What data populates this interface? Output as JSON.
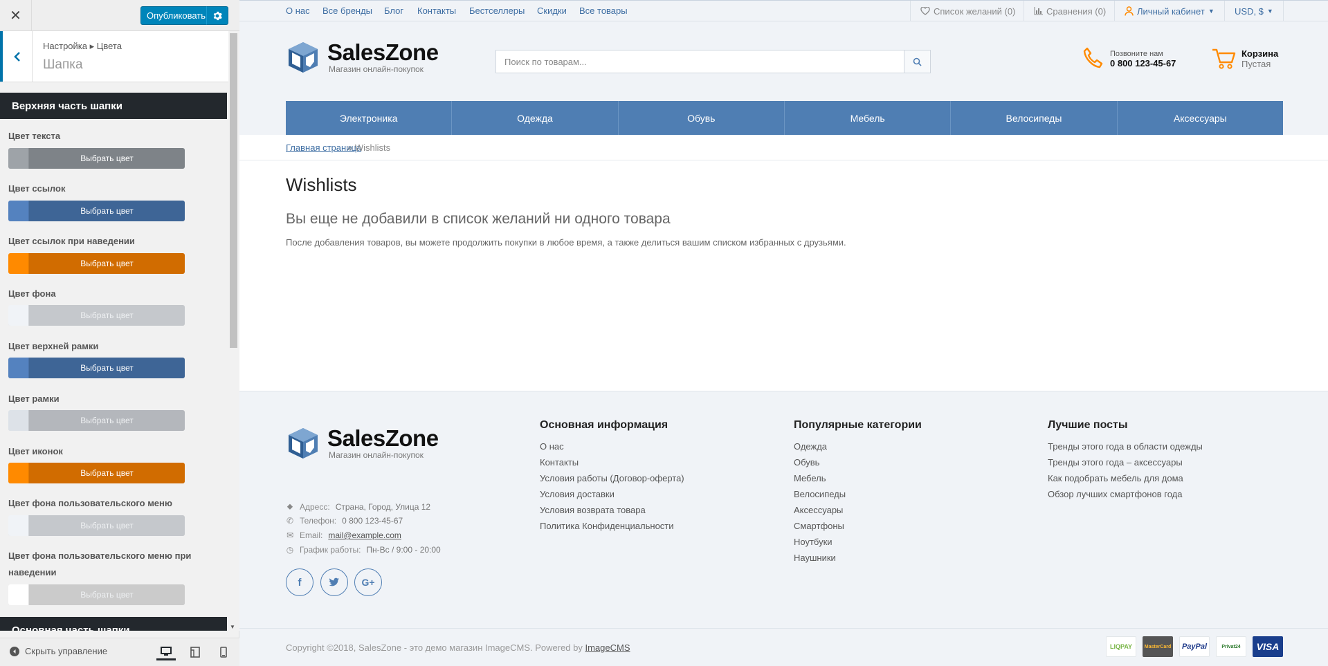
{
  "panel": {
    "publish_label": "Опубликовать",
    "breadcrumb": "Настройка ▸ Цвета",
    "section_title": "Шапка",
    "group_top": "Верхняя часть шапки",
    "group_main": "Основная часть шапки",
    "choose_color": "Выбрать цвет",
    "controls": [
      {
        "label": "Цвет текста",
        "color": "#9ea3a8",
        "btn_color": "#7e8388"
      },
      {
        "label": "Цвет ссылок",
        "color": "#5482bf",
        "btn_color": "#3e6596"
      },
      {
        "label": "Цвет ссылок при наведении",
        "color": "#ff8a00",
        "btn_color": "#d16c00"
      },
      {
        "label": "Цвет фона",
        "color": "#f0f3f7",
        "btn_color": "#c5c8cc"
      },
      {
        "label": "Цвет верхней рамки",
        "color": "#5482bf",
        "btn_color": "#3e6596"
      },
      {
        "label": "Цвет рамки",
        "color": "#dde2e8",
        "btn_color": "#b4b7bc"
      },
      {
        "label": "Цвет иконок",
        "color": "#ff8a00",
        "btn_color": "#d16c00"
      },
      {
        "label": "Цвет фона пользовательского меню",
        "color": "#f0f3f7",
        "btn_color": "#c5c8cc"
      },
      {
        "label": "Цвет фона пользовательского меню при наведении",
        "color": "#ffffff",
        "btn_color": "#cbcbcb"
      }
    ],
    "hide_controls": "Скрыть управление"
  },
  "site": {
    "topnav": [
      "О нас",
      "Все бренды",
      "Блог",
      "Контакты",
      "Бестселлеры",
      "Скидки",
      "Все товары"
    ],
    "wishlist": "Список желаний (0)",
    "compare": "Сравнения (0)",
    "account": "Личный кабинет",
    "currency": "USD, $",
    "logo_name": "SalesZone",
    "logo_tagline": "Магазин онлайн-покупок",
    "search_placeholder": "Поиск по товарам...",
    "phone_caption": "Позвоните нам",
    "phone_number": "0 800 123-45-67",
    "cart_title": "Корзина",
    "cart_status": "Пустая",
    "categories": [
      "Электроника",
      "Одежда",
      "Обувь",
      "Мебель",
      "Велосипеды",
      "Аксессуары"
    ],
    "crumb_home": "Главная страница",
    "crumb_current": "» Wishlists",
    "page_title": "Wishlists",
    "empty_title": "Вы еще не добавили в список желаний ни одного товара",
    "empty_text": "После добавления товаров, вы можете продолжить покупки в любое время, а также делиться вашим списком избранных с друзьями.",
    "address_label": "Адресс:",
    "address": "Страна, Город, Улица 12",
    "phone_label": "Телефон:",
    "email_label": "Email:",
    "email": "mail@example.com",
    "hours_label": "График работы:",
    "hours": "Пн-Вс / 9:00 - 20:00",
    "col1_title": "Основная информация",
    "col1_links": [
      "О нас",
      "Контакты",
      "Условия работы (Договор-оферта)",
      "Условия доставки",
      "Условия возврата товара",
      "Политика Конфиденциальности"
    ],
    "col2_title": "Популярные категории",
    "col2_links": [
      "Одежда",
      "Обувь",
      "Мебель",
      "Велосипеды",
      "Аксессуары",
      "Смартфоны",
      "Ноутбуки",
      "Наушники"
    ],
    "col3_title": "Лучшие посты",
    "col3_links": [
      "Тренды этого года в области одежды",
      "Тренды этого года – аксессуары",
      "Как подобрать мебель для дома",
      "Обзор лучших смартфонов года"
    ],
    "copyright": "Copyright ©2018, SalesZone - это демо магазин ImageCMS. Powered by",
    "copyright_link": "ImageCMS",
    "payments": [
      "LIQPAY",
      "MasterCard",
      "PayPal",
      "Privat24",
      "VISA"
    ]
  },
  "colors": {
    "accent": "#4f7eb3",
    "orange": "#ff8a00",
    "wp_blue": "#0085ba"
  }
}
